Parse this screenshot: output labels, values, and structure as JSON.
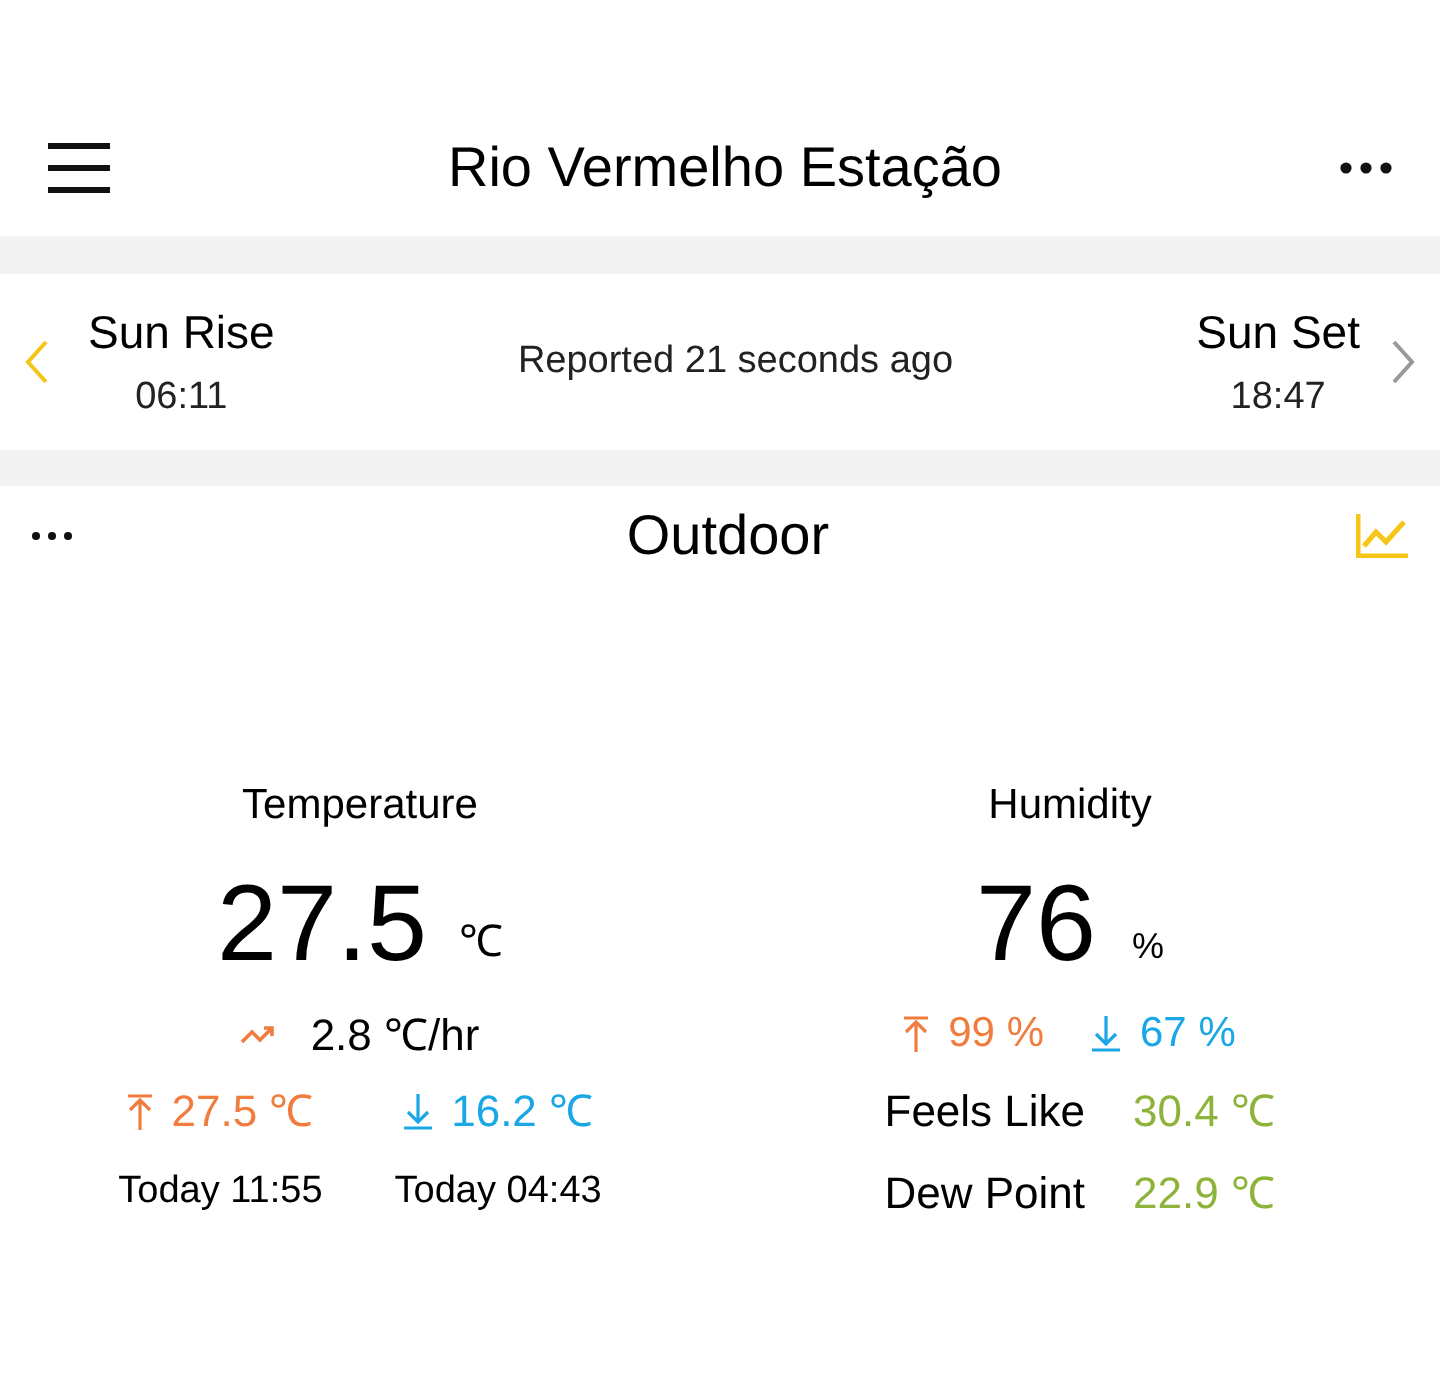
{
  "header": {
    "title": "Rio Vermelho Estação"
  },
  "sun": {
    "sunrise_label": "Sun Rise",
    "sunrise_time": "06:11",
    "reported": "Reported 21 seconds ago",
    "sunset_label": "Sun Set",
    "sunset_time": "18:47"
  },
  "section": {
    "title": "Outdoor"
  },
  "temperature": {
    "label": "Temperature",
    "value": "27.5",
    "unit": "℃",
    "trend": "2.8 ℃/hr",
    "extremes": [
      {
        "kind": "high",
        "value": "27.5 ℃",
        "time": "Today 11:55"
      },
      {
        "kind": "low",
        "value": "16.2 ℃",
        "time": "Today 04:43"
      }
    ]
  },
  "humidity": {
    "label": "Humidity",
    "value": "76",
    "unit": "%",
    "extremes": [
      {
        "kind": "high",
        "value": "99 %"
      },
      {
        "kind": "low",
        "value": "67 %"
      }
    ],
    "details": [
      {
        "label": "Feels Like",
        "value": "30.4 ℃"
      },
      {
        "label": "Dew Point",
        "value": "22.9 ℃"
      }
    ]
  }
}
